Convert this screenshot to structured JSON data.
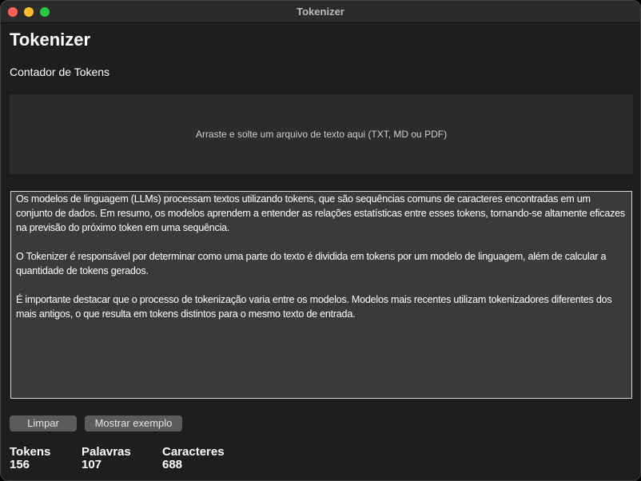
{
  "window": {
    "title": "Tokenizer"
  },
  "header": {
    "title": "Tokenizer",
    "subtitle": "Contador de Tokens"
  },
  "dropzone": {
    "label": "Arraste e solte um arquivo de texto aqui (TXT, MD ou PDF)"
  },
  "text_input": {
    "paragraphs": [
      "Os modelos de linguagem (LLMs) processam textos utilizando tokens, que são sequências comuns de caracteres encontradas em um conjunto de dados. Em resumo, os modelos aprendem a entender as relações estatísticas entre esses tokens, tornando-se altamente eficazes na previsão do próximo token em uma sequência.",
      "O Tokenizer é responsável por determinar como uma parte do texto é dividida em tokens por um modelo de linguagem, além de calcular a quantidade de tokens gerados.",
      "É importante destacar que o processo de tokenização varia entre os modelos. Modelos mais recentes utilizam tokenizadores diferentes dos mais antigos, o que resulta em tokens distintos para o mesmo texto de entrada."
    ]
  },
  "buttons": {
    "clear": "Limpar",
    "example": "Mostrar exemplo"
  },
  "stats": [
    {
      "label": "Tokens",
      "value": "156"
    },
    {
      "label": "Palavras",
      "value": "107"
    },
    {
      "label": "Caracteres",
      "value": "688"
    }
  ]
}
